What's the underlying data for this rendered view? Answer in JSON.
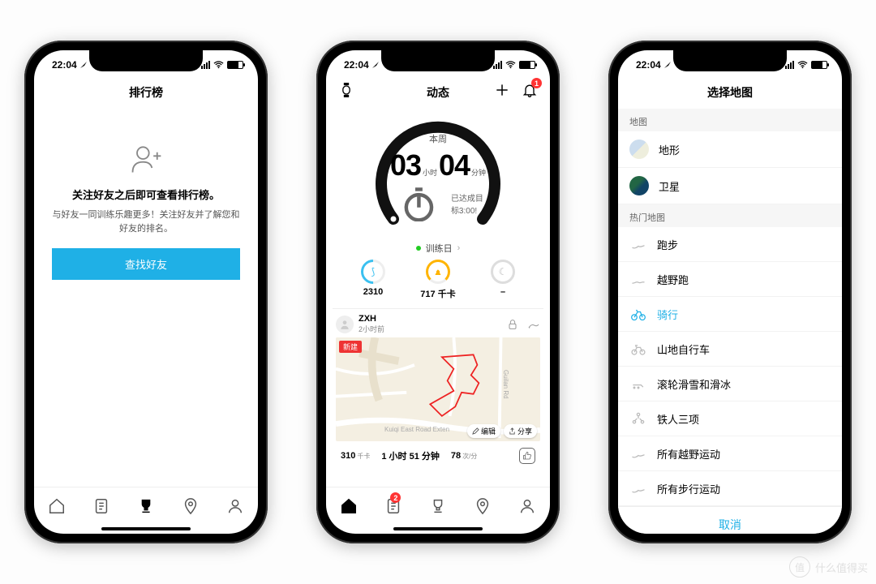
{
  "status": {
    "time": "22:04"
  },
  "watermark": {
    "char": "值",
    "text": "什么值得买"
  },
  "p1": {
    "title": "排行榜",
    "heading": "关注好友之后即可查看排行榜。",
    "sub": "与好友一同训练乐趣更多！关注好友并了解您和好友的排名。",
    "button": "查找好友"
  },
  "p2": {
    "title": "动态",
    "bell_badge": "1",
    "gauge": {
      "label": "本周",
      "h_val": "03",
      "h_unit": "小时",
      "m_val": "04",
      "m_unit": "分钟",
      "sub": "已达成目标3:00!"
    },
    "trainday": "训练日",
    "metrics": {
      "steps": "2310",
      "cal": "717 千卡",
      "sleep": "–"
    },
    "feed": {
      "name": "ZXH",
      "time": "2小时前",
      "newtag": "新建",
      "road1": "Guilan Rd",
      "road2": "Kuiqi East Road Exten",
      "edit": "编辑",
      "share": "分享",
      "s1": "310",
      "s1u": "千卡",
      "s2": "1 小时 51 分钟",
      "s3": "78",
      "s3u": "次/分"
    },
    "tab_badge": "2"
  },
  "p3": {
    "title": "选择地图",
    "sec_map": "地图",
    "sec_hot": "热门地图",
    "rows": {
      "terrain": "地形",
      "sat": "卫星",
      "run": "跑步",
      "trail": "越野跑",
      "cycle": "骑行",
      "mtb": "山地自行车",
      "skate": "滚轮滑雪和滑冰",
      "tri": "铁人三项",
      "alloff": "所有越野运动",
      "allwalk": "所有步行运动"
    },
    "cancel": "取消"
  }
}
